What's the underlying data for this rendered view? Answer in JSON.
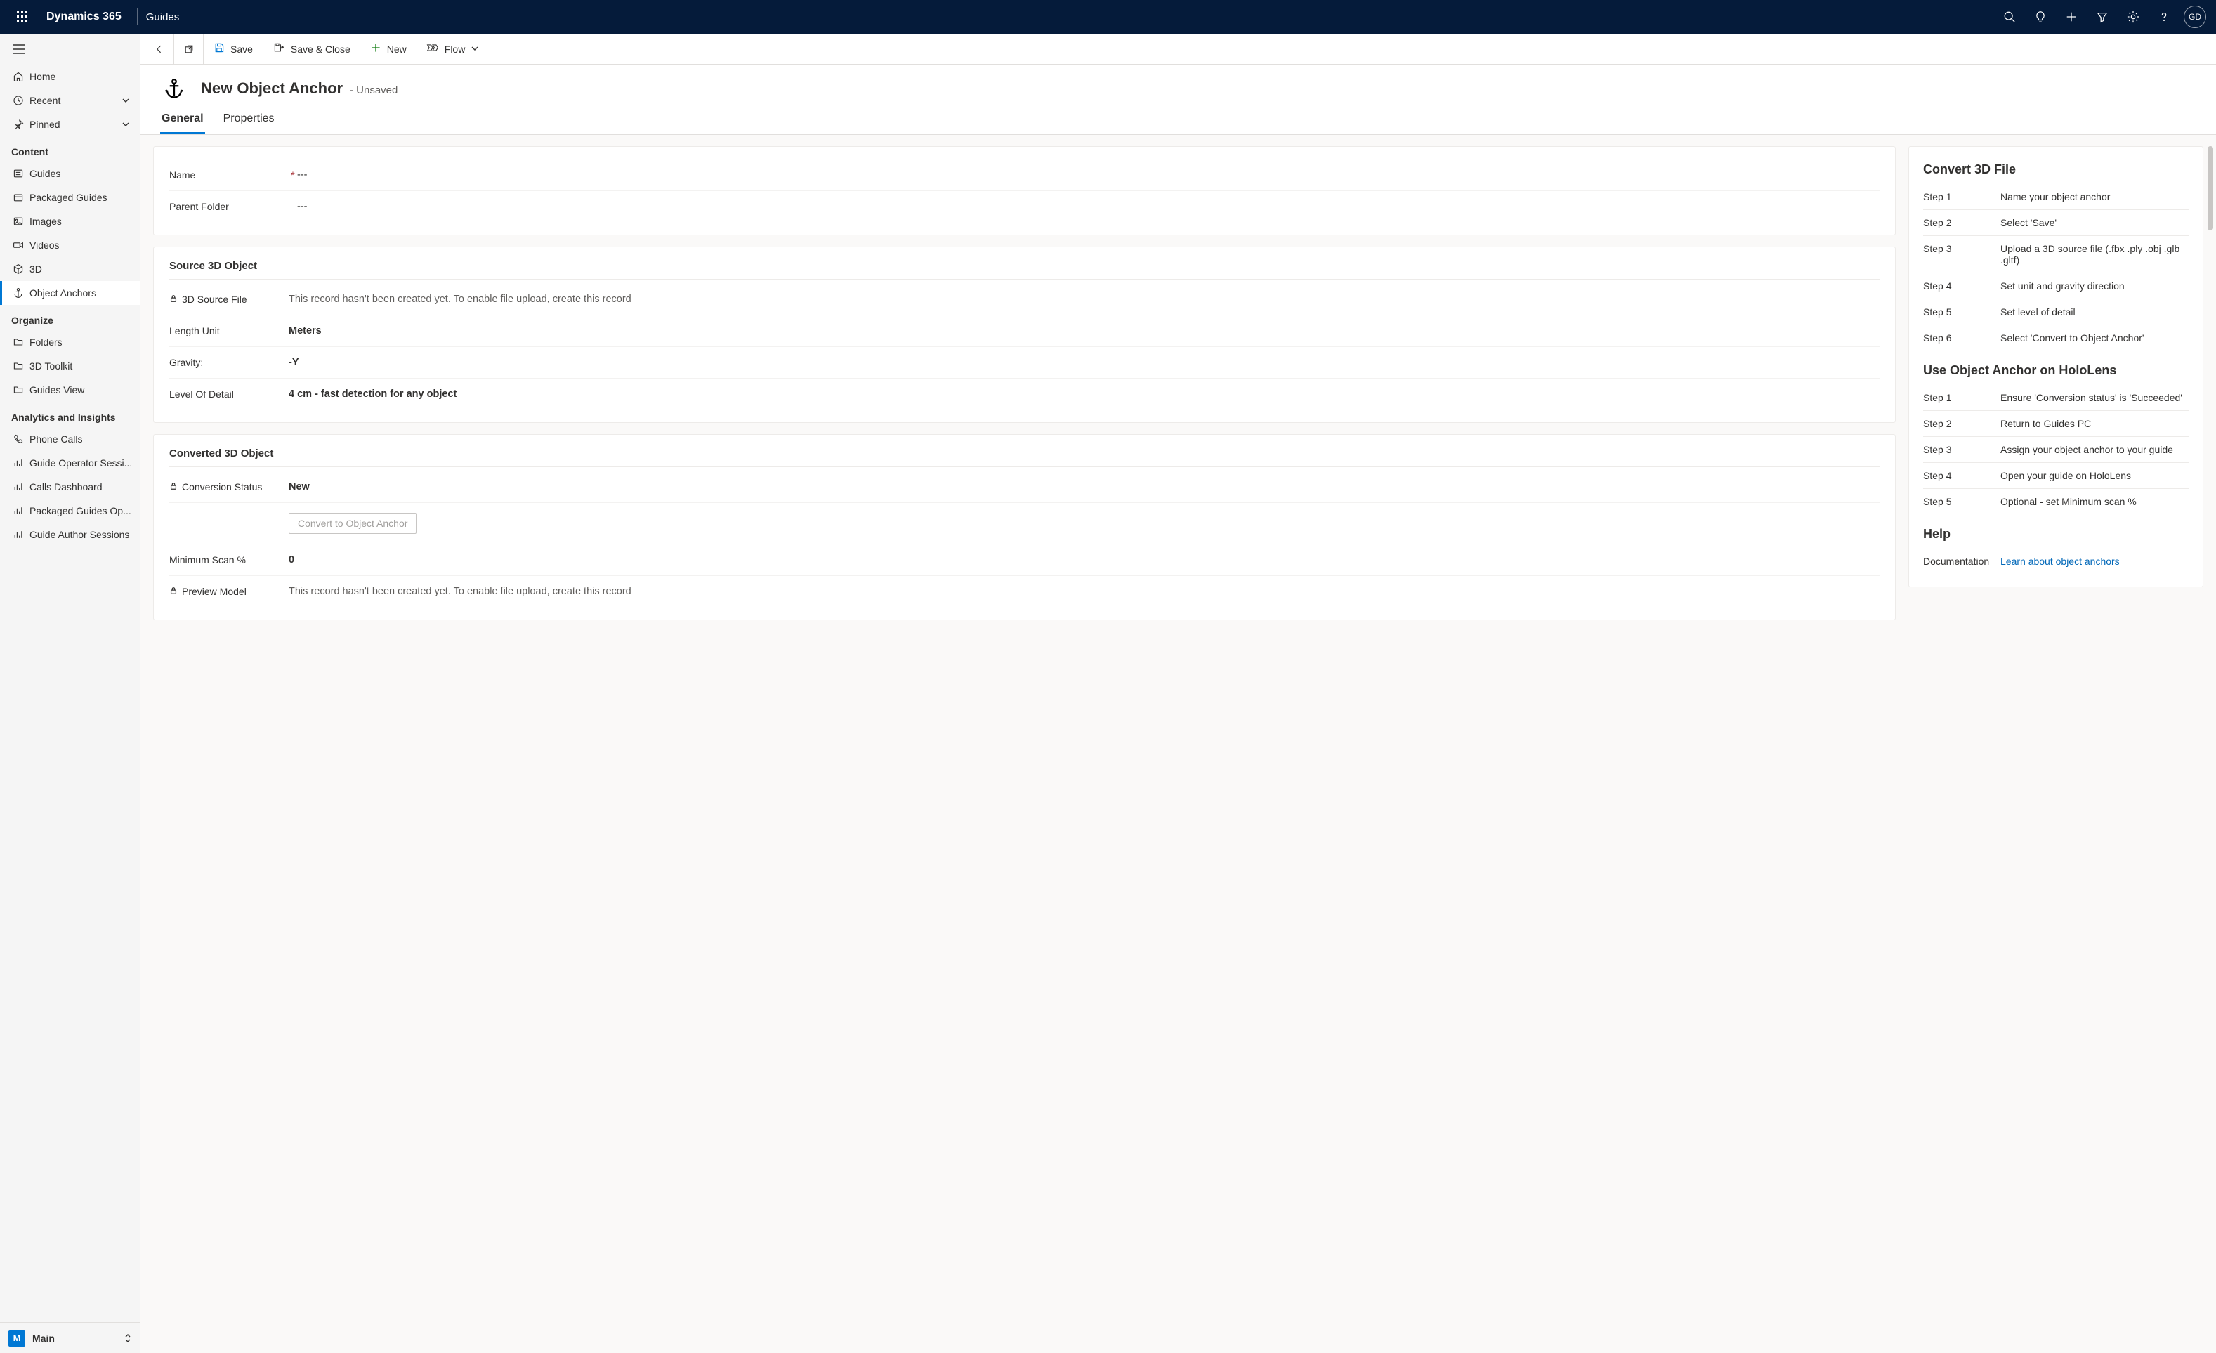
{
  "topnav": {
    "brand": "Dynamics 365",
    "app": "Guides",
    "avatar_initials": "GD"
  },
  "sidebar": {
    "nav_primary": [
      {
        "label": "Home"
      },
      {
        "label": "Recent",
        "chev": true
      },
      {
        "label": "Pinned",
        "chev": true
      }
    ],
    "group_content": "Content",
    "content_items": [
      {
        "label": "Guides"
      },
      {
        "label": "Packaged Guides"
      },
      {
        "label": "Images"
      },
      {
        "label": "Videos"
      },
      {
        "label": "3D"
      },
      {
        "label": "Object Anchors",
        "active": true
      }
    ],
    "group_organize": "Organize",
    "organize_items": [
      {
        "label": "Folders"
      },
      {
        "label": "3D Toolkit"
      },
      {
        "label": "Guides View"
      }
    ],
    "group_analytics": "Analytics and Insights",
    "analytics_items": [
      {
        "label": "Phone Calls"
      },
      {
        "label": "Guide Operator Sessi..."
      },
      {
        "label": "Calls Dashboard"
      },
      {
        "label": "Packaged Guides Op..."
      },
      {
        "label": "Guide Author Sessions"
      }
    ],
    "footer": {
      "badge": "M",
      "label": "Main"
    }
  },
  "commandbar": {
    "save": "Save",
    "save_close": "Save & Close",
    "new": "New",
    "flow": "Flow"
  },
  "record": {
    "title": "New Object Anchor",
    "status": "- Unsaved",
    "tabs": {
      "general": "General",
      "properties": "Properties"
    }
  },
  "form": {
    "top": {
      "name_label": "Name",
      "name_value": "---",
      "parent_label": "Parent Folder",
      "parent_value": "---"
    },
    "source": {
      "heading": "Source 3D Object",
      "file_label": "3D Source File",
      "file_placeholder": "This record hasn't been created yet. To enable file upload, create this record",
      "unit_label": "Length Unit",
      "unit_value": "Meters",
      "gravity_label": "Gravity:",
      "gravity_value": "-Y",
      "lod_label": "Level Of Detail",
      "lod_value": "4 cm - fast detection for any object"
    },
    "converted": {
      "heading": "Converted 3D Object",
      "status_label": "Conversion Status",
      "status_value": "New",
      "convert_btn": "Convert to Object Anchor",
      "min_label": "Minimum Scan %",
      "min_value": "0",
      "preview_label": "Preview Model",
      "preview_placeholder": "This record hasn't been created yet. To enable file upload, create this record"
    }
  },
  "sidepanel": {
    "convert_heading": "Convert 3D File",
    "convert_steps": [
      {
        "n": "Step 1",
        "d": "Name your object anchor"
      },
      {
        "n": "Step 2",
        "d": "Select 'Save'"
      },
      {
        "n": "Step 3",
        "d": "Upload a 3D source file (.fbx .ply .obj .glb .gltf)"
      },
      {
        "n": "Step 4",
        "d": "Set unit and gravity direction"
      },
      {
        "n": "Step 5",
        "d": "Set level of detail"
      },
      {
        "n": "Step 6",
        "d": "Select 'Convert to Object Anchor'"
      }
    ],
    "use_heading": "Use Object Anchor on HoloLens",
    "use_steps": [
      {
        "n": "Step 1",
        "d": "Ensure 'Conversion status' is 'Succeeded'"
      },
      {
        "n": "Step 2",
        "d": "Return to Guides PC"
      },
      {
        "n": "Step 3",
        "d": "Assign your object anchor to your guide"
      },
      {
        "n": "Step 4",
        "d": "Open your guide on HoloLens"
      },
      {
        "n": "Step 5",
        "d": "Optional - set Minimum scan %"
      }
    ],
    "help_heading": "Help",
    "help_label": "Documentation",
    "help_link": "Learn about object anchors"
  }
}
